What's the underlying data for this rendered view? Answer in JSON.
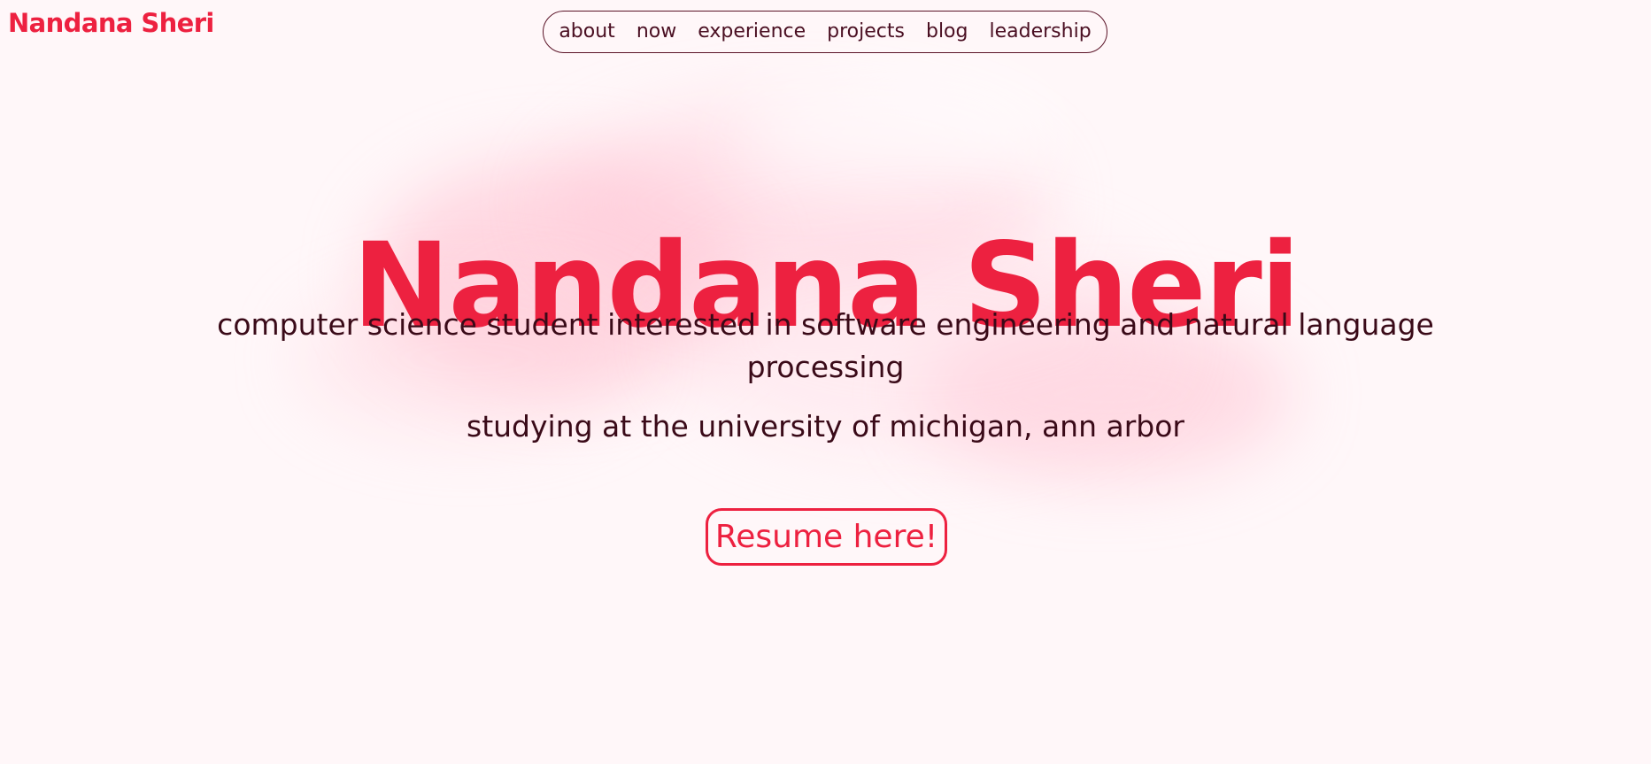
{
  "header": {
    "brand": "Nandana Sheri",
    "nav": [
      "about",
      "now",
      "experience",
      "projects",
      "blog",
      "leadership"
    ]
  },
  "hero": {
    "name": "Nandana Sheri",
    "tagline": "computer science student interested in software engineering and natural language processing",
    "school": "studying at the university of michigan, ann arbor",
    "resume_button": "Resume here!"
  },
  "colors": {
    "background": "#fff7f9",
    "accent": "#ed2140",
    "text": "#3a0a18",
    "nav_border": "#5a1327"
  }
}
